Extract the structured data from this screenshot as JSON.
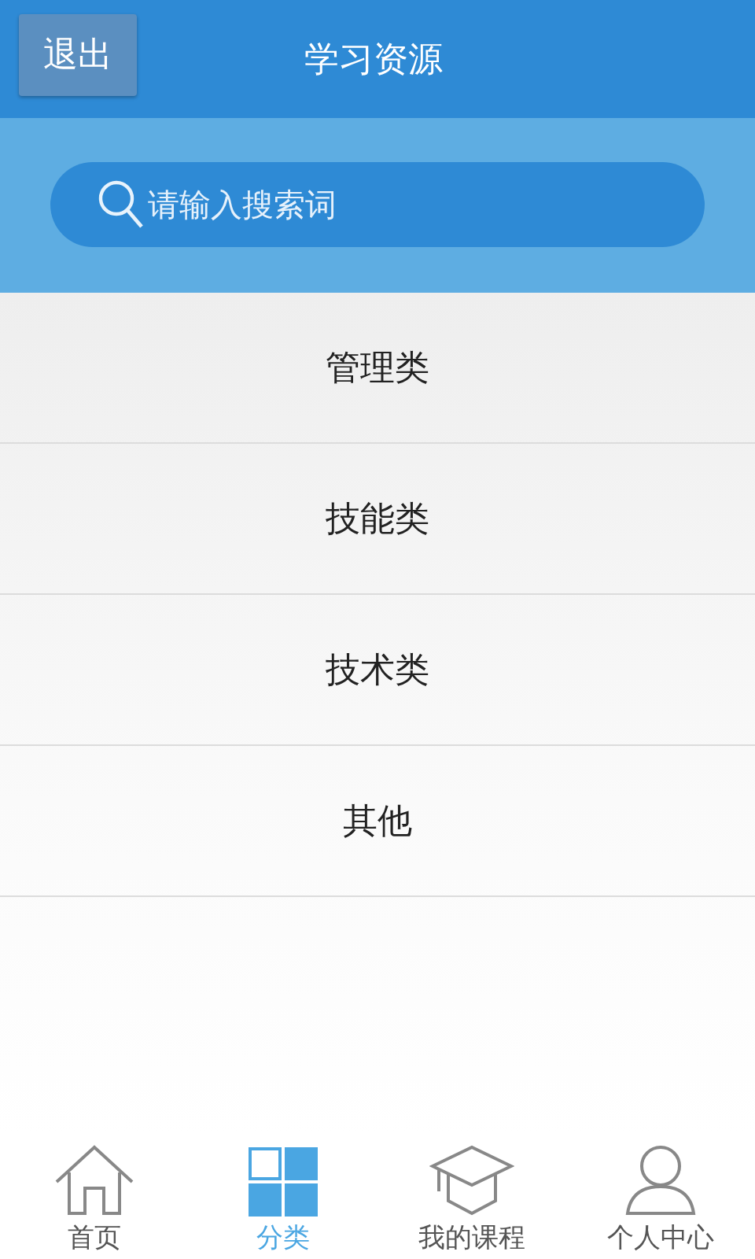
{
  "header": {
    "back_button": "退出",
    "title": "学习资源"
  },
  "search": {
    "placeholder": "请输入搜索词"
  },
  "categories": [
    "管理类",
    "技能类",
    "技术类",
    "其他"
  ],
  "tabs": [
    {
      "kind": "home",
      "label": "首页",
      "selected": false
    },
    {
      "kind": "grid",
      "label": "分类",
      "selected": true
    },
    {
      "kind": "cap",
      "label": "我的课程",
      "selected": false
    },
    {
      "kind": "person",
      "label": "个人中心",
      "selected": false
    }
  ]
}
